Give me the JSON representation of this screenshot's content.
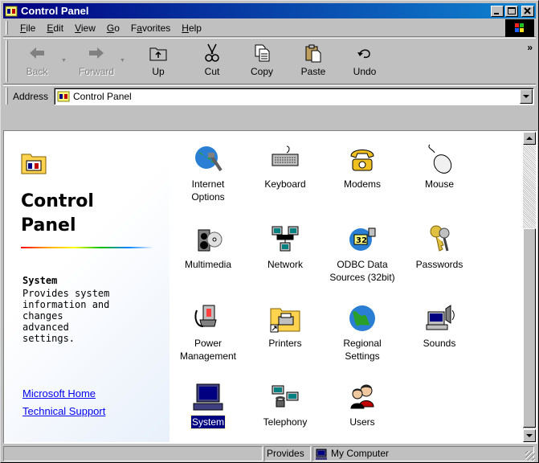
{
  "window": {
    "title": "Control Panel"
  },
  "menubar": {
    "items": [
      {
        "label": "File",
        "accel": "F",
        "rest": "ile"
      },
      {
        "label": "Edit",
        "accel": "E",
        "rest": "dit"
      },
      {
        "label": "View",
        "accel": "V",
        "rest": "iew"
      },
      {
        "label": "Go",
        "accel": "G",
        "rest": "o"
      },
      {
        "label": "Favorites",
        "accel": "a",
        "pre": "F",
        "rest": "vorites"
      },
      {
        "label": "Help",
        "accel": "H",
        "rest": "elp"
      }
    ]
  },
  "toolbar": {
    "back": "Back",
    "forward": "Forward",
    "up": "Up",
    "cut": "Cut",
    "copy": "Copy",
    "paste": "Paste",
    "undo": "Undo",
    "more": "»"
  },
  "address": {
    "label": "Address",
    "value": "Control Panel"
  },
  "sidepanel": {
    "title_line1": "Control",
    "title_line2": "Panel",
    "selected_title": "System",
    "selected_desc": "Provides system\ninformation and\nchanges\nadvanced\nsettings.",
    "links": [
      "Microsoft Home",
      "Technical Support"
    ]
  },
  "items": [
    {
      "name": "Internet\nOptions",
      "icon": "internet-options-icon"
    },
    {
      "name": "Keyboard",
      "icon": "keyboard-icon"
    },
    {
      "name": "Modems",
      "icon": "modem-phone-icon"
    },
    {
      "name": "Mouse",
      "icon": "mouse-icon"
    },
    {
      "name": "Multimedia",
      "icon": "multimedia-icon"
    },
    {
      "name": "Network",
      "icon": "network-icon"
    },
    {
      "name": "ODBC Data\nSources (32bit)",
      "icon": "odbc-icon"
    },
    {
      "name": "Passwords",
      "icon": "keys-icon"
    },
    {
      "name": "Power\nManagement",
      "icon": "power-plug-icon"
    },
    {
      "name": "Printers",
      "icon": "printers-folder-icon"
    },
    {
      "name": "Regional\nSettings",
      "icon": "globe-icon"
    },
    {
      "name": "Sounds",
      "icon": "speaker-icon"
    },
    {
      "name": "System",
      "icon": "computer-icon",
      "selected": true
    },
    {
      "name": "Telephony",
      "icon": "telephony-icon"
    },
    {
      "name": "Users",
      "icon": "users-icon"
    }
  ],
  "statusbar": {
    "description": "Provides",
    "zone": "My Computer"
  },
  "colors": {
    "title_gradient_start": "#000080",
    "title_gradient_end": "#1084d0",
    "selection": "#000080",
    "link": "#0000ee",
    "chrome": "#c0c0c0"
  }
}
